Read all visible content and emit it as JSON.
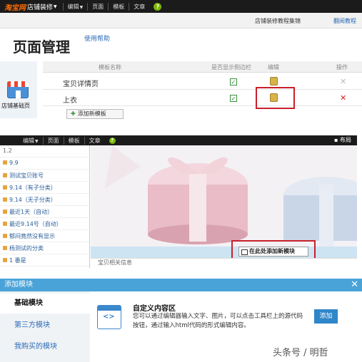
{
  "topbar": {
    "logo": "淘宝网",
    "shop": "店铺装修",
    "menus": [
      "编辑",
      "页面",
      "模板",
      "文章"
    ],
    "help_icon": "?"
  },
  "subbar": {
    "tutorial": "店铺装修教程集锦",
    "chain": "翻阅教程"
  },
  "page": {
    "title": "页面管理",
    "help_link": "使用帮助"
  },
  "sidebar": {
    "label": "店铺基础页"
  },
  "table": {
    "headers": [
      "模板名称",
      "是否显示侧边栏",
      "编辑",
      "操作"
    ],
    "rows": [
      {
        "name": "宝贝详情页"
      },
      {
        "name": "上衣"
      }
    ],
    "checkmark": "✓",
    "delete_glyph": "✕",
    "add_button": "添加新模板"
  },
  "editor_bar": {
    "menus": [
      "编辑",
      "页面",
      "模板",
      "文章"
    ],
    "layout": "布局"
  },
  "side_list": [
    "1.2",
    "9.9",
    "测试宝贝账号",
    "9.14（有子分类）",
    "9.14（无子分类）",
    "最近1天（自动）",
    "最近9.14号（自动）",
    "郁闷竟然没有显示",
    "杨测试的分类",
    "1 番是"
  ],
  "stage": {
    "add_module": "在此处添加新模块",
    "below_text": "宝贝相关信息"
  },
  "dialog": {
    "title": "添加模块",
    "close": "✕",
    "categories": [
      "基础模块",
      "第三方模块",
      "我购买的模块"
    ],
    "module": {
      "icon": "<>",
      "title": "自定义内容区",
      "desc": "您可以通过编辑器输入文字、图片，可以点击工具栏上的源代码按钮，通过输入html代码的形式编辑内容。",
      "add": "添加"
    }
  },
  "watermark": "头条号 / 明哲",
  "colors": {
    "accent": "#4aa3d8",
    "highlight": "#c8202a",
    "logo": "#ff6a00"
  }
}
